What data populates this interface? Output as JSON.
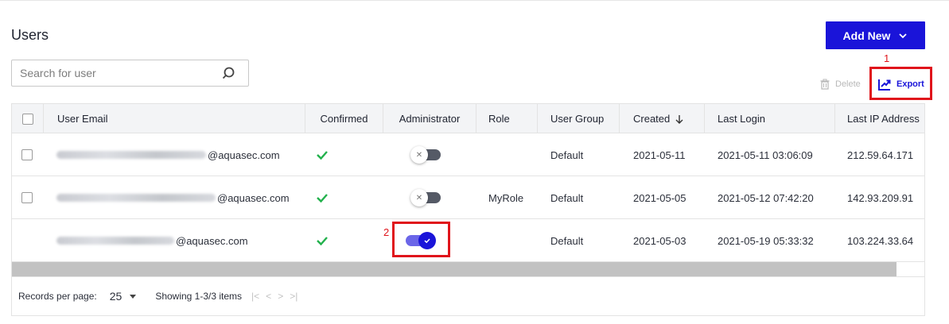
{
  "page": {
    "title": "Users"
  },
  "toolbar": {
    "add_new_label": "Add New",
    "delete_label": "Delete",
    "export_label": "Export"
  },
  "search": {
    "placeholder": "Search for user",
    "value": ""
  },
  "annotations": {
    "export_marker": "1",
    "toggle_marker": "2",
    "color": "#e0141b"
  },
  "colors": {
    "accent": "#1a14d9",
    "confirmed_check": "#22b14c",
    "toggle_on_track": "#6b66e8",
    "toggle_off_track": "#555a66"
  },
  "table": {
    "columns": [
      "User Email",
      "Confirmed",
      "Administrator",
      "Role",
      "User Group",
      "Created",
      "Last Login",
      "Last IP Address"
    ],
    "sort": {
      "column": "Created",
      "direction": "descending",
      "icon": "arrow-down-icon"
    },
    "rows": [
      {
        "email_domain": "@aquasec.com",
        "confirmed": true,
        "administrator": false,
        "role": "",
        "group": "Default",
        "created": "2021-05-11",
        "last_login": "2021-05-11 03:06:09",
        "last_ip": "212.59.64.171"
      },
      {
        "email_domain": "@aquasec.com",
        "confirmed": true,
        "administrator": false,
        "role": "MyRole",
        "group": "Default",
        "created": "2021-05-05",
        "last_login": "2021-05-12 07:42:20",
        "last_ip": "142.93.209.91"
      },
      {
        "email_domain": "@aquasec.com",
        "confirmed": true,
        "administrator": true,
        "role": "",
        "group": "Default",
        "created": "2021-05-03",
        "last_login": "2021-05-19 05:33:32",
        "last_ip": "103.224.33.64"
      }
    ]
  },
  "footer": {
    "records_per_page_label": "Records per page:",
    "records_per_page_value": "25",
    "showing": "Showing 1-3/3 items"
  }
}
